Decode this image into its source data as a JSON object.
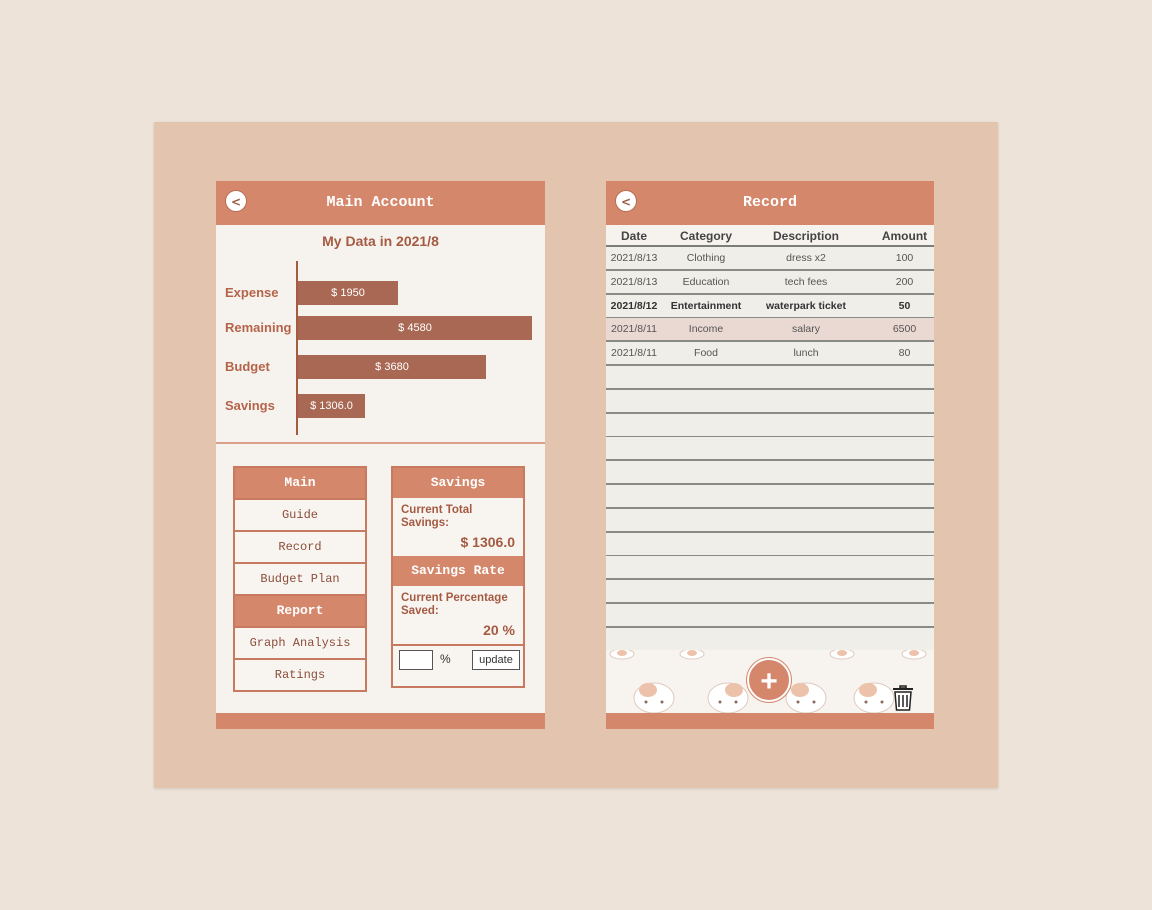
{
  "main_account": {
    "title": "Main Account",
    "back_label": "<",
    "chart_title": "My Data in 2021/8",
    "menu": {
      "main_header": "Main",
      "items_main": [
        "Guide",
        "Record",
        "Budget Plan"
      ],
      "report_header": "Report",
      "items_report": [
        "Graph Analysis",
        "Ratings"
      ]
    },
    "savings": {
      "header": "Savings",
      "total_label": "Current Total Savings:",
      "total_value": "$ 1306.0",
      "rate_header": "Savings Rate",
      "rate_label": "Current Percentage Saved:",
      "rate_value": "20 %",
      "percent_input_value": "",
      "percent_sign": "%",
      "update_label": "update"
    }
  },
  "chart_data": {
    "type": "bar",
    "orientation": "horizontal",
    "title": "My Data in 2021/8",
    "categories": [
      "Expense",
      "Remaining",
      "Budget",
      "Savings"
    ],
    "values": [
      1950,
      4580,
      3680,
      1306.0
    ],
    "data_labels": [
      "$ 1950",
      "$ 4580",
      "$ 3680",
      "$ 1306.0"
    ],
    "bar_color": "#a96853",
    "xlim": [
      0,
      4580
    ]
  },
  "record": {
    "title": "Record",
    "back_label": "<",
    "columns": [
      "Date",
      "Category",
      "Description",
      "Amount"
    ],
    "rows": [
      {
        "date": "2021/8/13",
        "category": "Clothing",
        "description": "dress x2",
        "amount": "100"
      },
      {
        "date": "2021/8/13",
        "category": "Education",
        "description": "tech fees",
        "amount": "200"
      },
      {
        "date": "2021/8/12",
        "category": "Entertainment",
        "description": "waterpark ticket",
        "amount": "50"
      },
      {
        "date": "2021/8/11",
        "category": "Income",
        "description": "salary",
        "amount": "6500"
      },
      {
        "date": "2021/8/11",
        "category": "Food",
        "description": "lunch",
        "amount": "80"
      }
    ],
    "selected_row": 2,
    "highlighted_row": 3,
    "empty_rows": 12,
    "add_icon": "plus-icon",
    "delete_icon": "trash-icon"
  },
  "colors": {
    "accent": "#d5876b",
    "bar": "#a96853",
    "text_accent": "#a55a42",
    "background": "#ede3d9",
    "board": "#e2c4af"
  }
}
